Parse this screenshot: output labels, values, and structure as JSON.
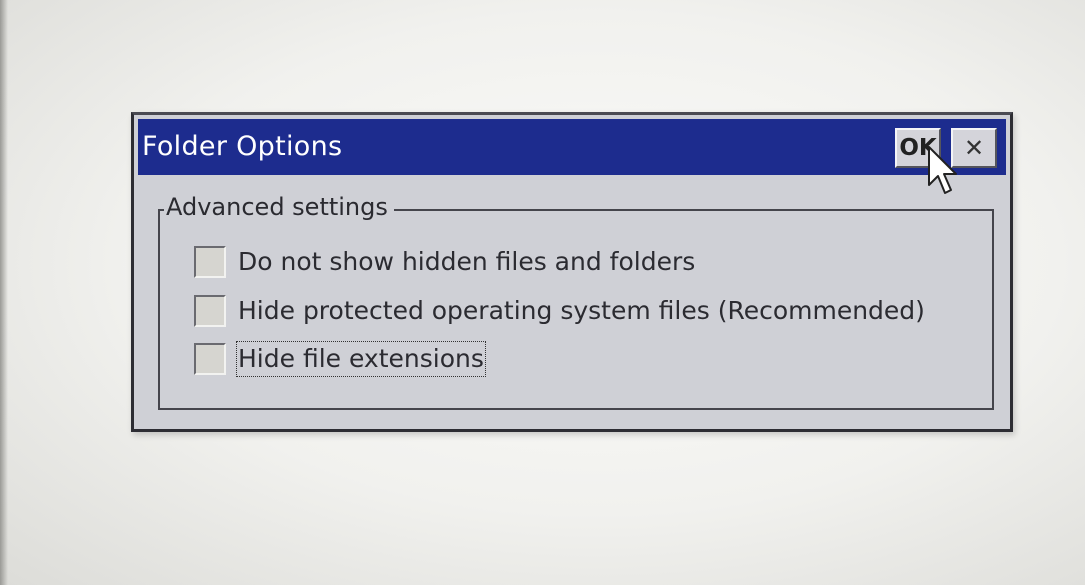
{
  "window": {
    "title": "Folder Options",
    "ok_label": "OK",
    "close_label": "✕"
  },
  "group": {
    "label": "Advanced settings",
    "options": [
      {
        "label": "Do not show hidden files and folders",
        "checked": false
      },
      {
        "label": "Hide protected operating system files (Recommended)",
        "checked": false
      },
      {
        "label": "Hide file extensions",
        "checked": false,
        "focused": true
      }
    ]
  },
  "colors": {
    "titlebar": "#1d2c8e",
    "dialog_bg": "#cfd0d6",
    "screen_bg": "#f2f2f0"
  },
  "icons": {
    "close": "close-icon",
    "cursor": "mouse-pointer-icon"
  }
}
